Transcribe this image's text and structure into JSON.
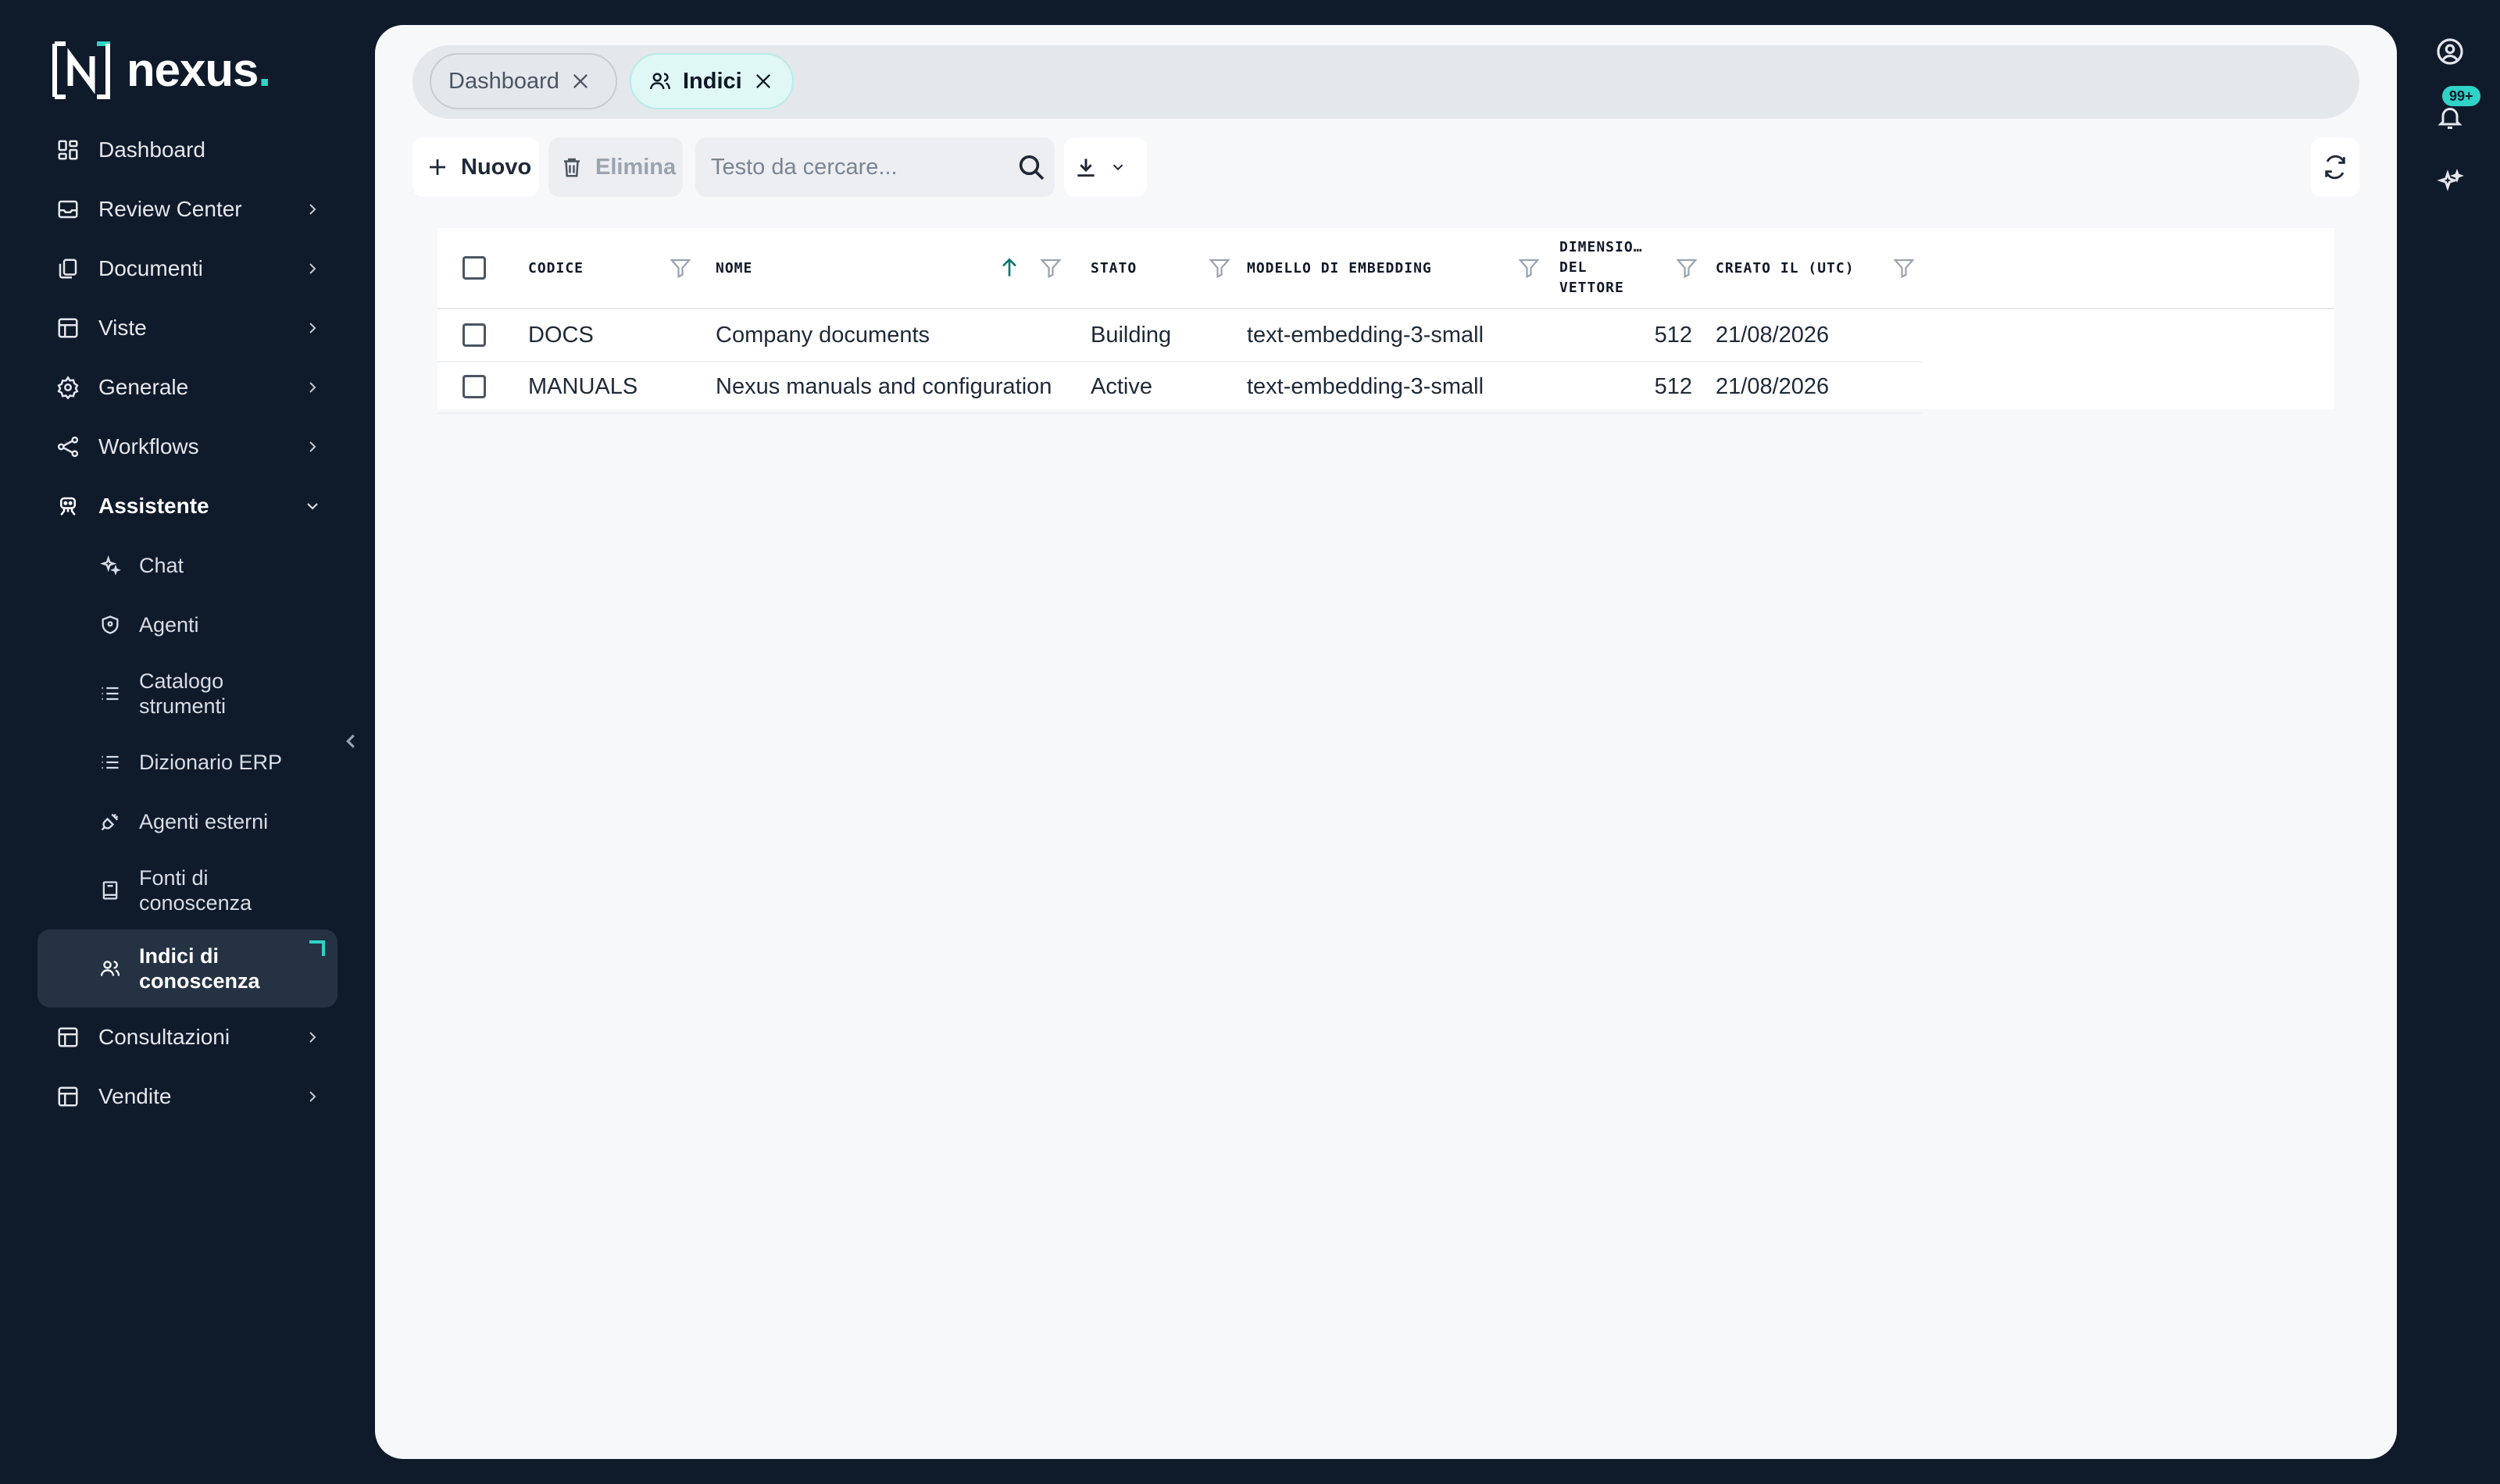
{
  "app": {
    "logo_text": "nexus",
    "logo_dot": ".",
    "accent_color": "#2fd3c7",
    "sidebar_bg": "#0f1a2b"
  },
  "sidebar": {
    "items": [
      {
        "label": "Dashboard",
        "icon": "dashboard-icon"
      },
      {
        "label": "Review Center",
        "icon": "inbox-icon"
      },
      {
        "label": "Documenti",
        "icon": "documents-icon"
      },
      {
        "label": "Viste",
        "icon": "table-icon"
      },
      {
        "label": "Generale",
        "icon": "gear-icon"
      },
      {
        "label": "Workflows",
        "icon": "workflow-icon"
      },
      {
        "label": "Assistente",
        "icon": "robot-icon",
        "expanded": true
      }
    ],
    "subitems": [
      {
        "label": "Chat",
        "icon": "sparkle-icon"
      },
      {
        "label": "Agenti",
        "icon": "shield-icon"
      },
      {
        "label": "Catalogo strumenti",
        "icon": "list-icon"
      },
      {
        "label": "Dizionario ERP",
        "icon": "list-icon"
      },
      {
        "label": "Agenti esterni",
        "icon": "plug-icon"
      },
      {
        "label": "Fonti di conoscenza",
        "icon": "book-icon"
      },
      {
        "label": "Indici di conoscenza",
        "icon": "users-icon",
        "active": true
      }
    ],
    "bottom_items": [
      {
        "label": "Consultazioni",
        "icon": "table-icon"
      },
      {
        "label": "Vendite",
        "icon": "table-icon"
      }
    ]
  },
  "rail": {
    "notifications_badge": "99+"
  },
  "tabs": [
    {
      "label": "Dashboard",
      "active": false
    },
    {
      "label": "Indici",
      "active": true
    }
  ],
  "toolbar": {
    "new_label": "Nuovo",
    "delete_label": "Elimina",
    "search_placeholder": "Testo da cercare..."
  },
  "table": {
    "columns": [
      "Codice",
      "Nome",
      "Stato",
      "Modello di embedding",
      "Dimensio… del vettore",
      "Creato il (UTC)"
    ],
    "column_lines": {
      "dimension": [
        "DIMENSIO…",
        "DEL",
        "VETTORE"
      ]
    },
    "sort": {
      "column": "Nome",
      "direction": "ascending"
    },
    "rows": [
      {
        "codice": "DOCS",
        "nome": "Company documents",
        "stato": "Building",
        "modello": "text-embedding-3-small",
        "dimensione": "512",
        "creato": "21/08/2026"
      },
      {
        "codice": "MANUALS",
        "nome": "Nexus manuals and configuration",
        "stato": "Active",
        "modello": "text-embedding-3-small",
        "dimensione": "512",
        "creato": "21/08/2026"
      }
    ]
  }
}
